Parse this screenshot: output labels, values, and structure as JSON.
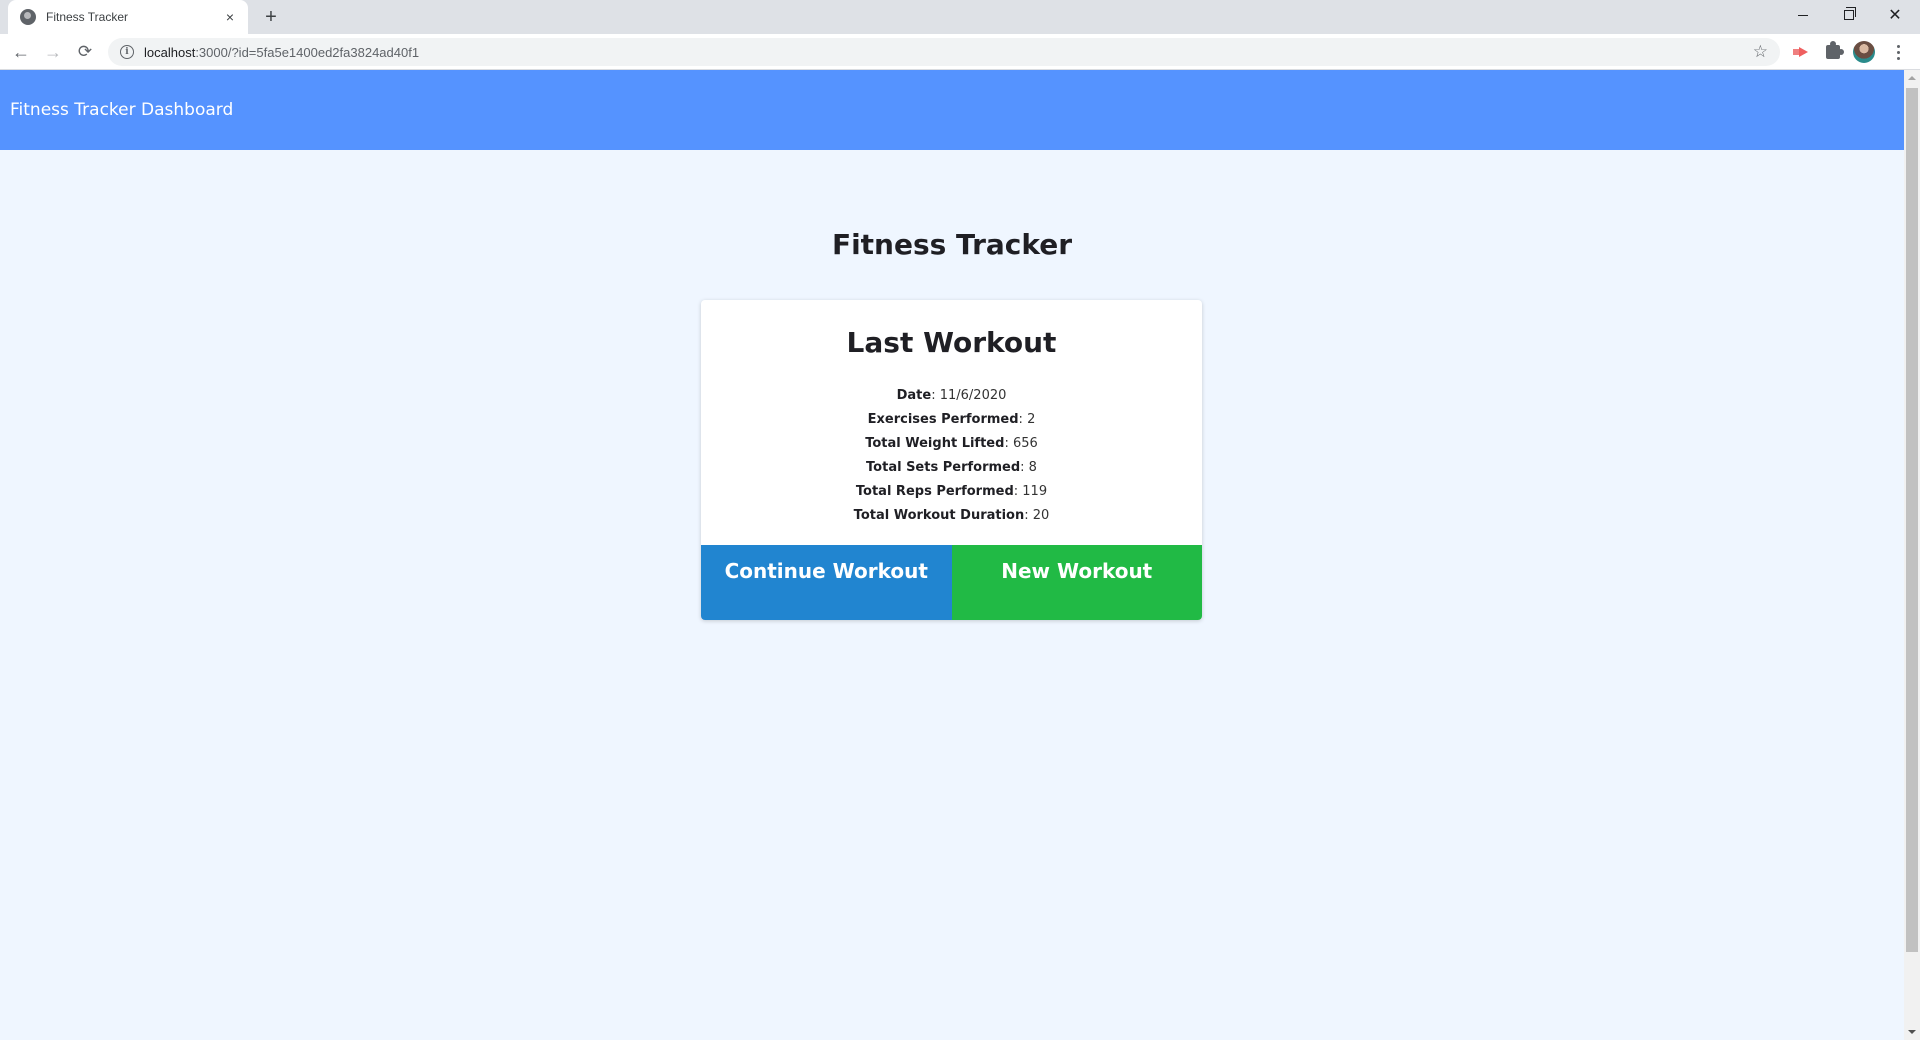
{
  "browser": {
    "tab_title": "Fitness Tracker",
    "tab_close_icon": "×",
    "new_tab_icon": "+",
    "url_host": "localhost",
    "url_path": ":3000/?id=5fa5e1400ed2fa3824ad40f1",
    "back_icon": "←",
    "forward_icon": "→",
    "reload_icon": "⟳",
    "info_icon": "i",
    "star_icon": "☆",
    "close_window_icon": "✕"
  },
  "header": {
    "brand": "Fitness Tracker Dashboard",
    "color": "#5593ff"
  },
  "main": {
    "title": "Fitness Tracker",
    "card": {
      "title": "Last Workout",
      "stats": [
        {
          "label": "Date",
          "value": "11/6/2020"
        },
        {
          "label": "Exercises Performed",
          "value": "2"
        },
        {
          "label": "Total Weight Lifted",
          "value": "656"
        },
        {
          "label": "Total Sets Performed",
          "value": "8"
        },
        {
          "label": "Total Reps Performed",
          "value": "119"
        },
        {
          "label": "Total Workout Duration",
          "value": "20"
        }
      ],
      "buttons": {
        "continue_label": "Continue Workout",
        "continue_color": "#2185d0",
        "new_label": "New Workout",
        "new_color": "#21ba45"
      }
    }
  }
}
